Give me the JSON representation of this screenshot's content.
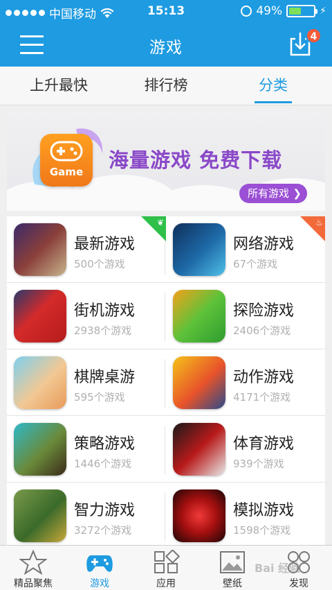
{
  "status_bar": {
    "carrier": "中国移动",
    "time": "15:13",
    "battery": "49%",
    "battery_level": 0.49
  },
  "header": {
    "title": "游戏",
    "download_badge": "4"
  },
  "tabs": [
    {
      "label": "上升最快",
      "active": false
    },
    {
      "label": "排行榜",
      "active": false
    },
    {
      "label": "分类",
      "active": true
    }
  ],
  "banner": {
    "icon_label": "Game",
    "slogan": "海量游戏 免费下载",
    "button_label": "所有游戏"
  },
  "categories": [
    {
      "name": "最新游戏",
      "count": "500个游戏",
      "corner": "new"
    },
    {
      "name": "网络游戏",
      "count": "67个游戏",
      "corner": "hot"
    },
    {
      "name": "街机游戏",
      "count": "2938个游戏"
    },
    {
      "name": "探险游戏",
      "count": "2406个游戏"
    },
    {
      "name": "棋牌桌游",
      "count": "595个游戏"
    },
    {
      "name": "动作游戏",
      "count": "4171个游戏"
    },
    {
      "name": "策略游戏",
      "count": "1446个游戏"
    },
    {
      "name": "体育游戏",
      "count": "939个游戏"
    },
    {
      "name": "智力游戏",
      "count": "3272个游戏"
    },
    {
      "name": "模拟游戏",
      "count": "1598个游戏"
    }
  ],
  "bottom_nav": [
    {
      "label": "精品聚焦",
      "icon": "star-icon",
      "active": false
    },
    {
      "label": "游戏",
      "icon": "gamepad-icon",
      "active": true
    },
    {
      "label": "应用",
      "icon": "apps-icon",
      "active": false
    },
    {
      "label": "壁纸",
      "icon": "image-icon",
      "active": false
    },
    {
      "label": "发现",
      "icon": "discover-icon",
      "active": false
    }
  ],
  "watermark": "Bai  经验",
  "colors": {
    "primary": "#1e9be1",
    "purple": "#9b4fd4",
    "new_corner": "#2fc04a",
    "hot_corner": "#f36a3a"
  }
}
